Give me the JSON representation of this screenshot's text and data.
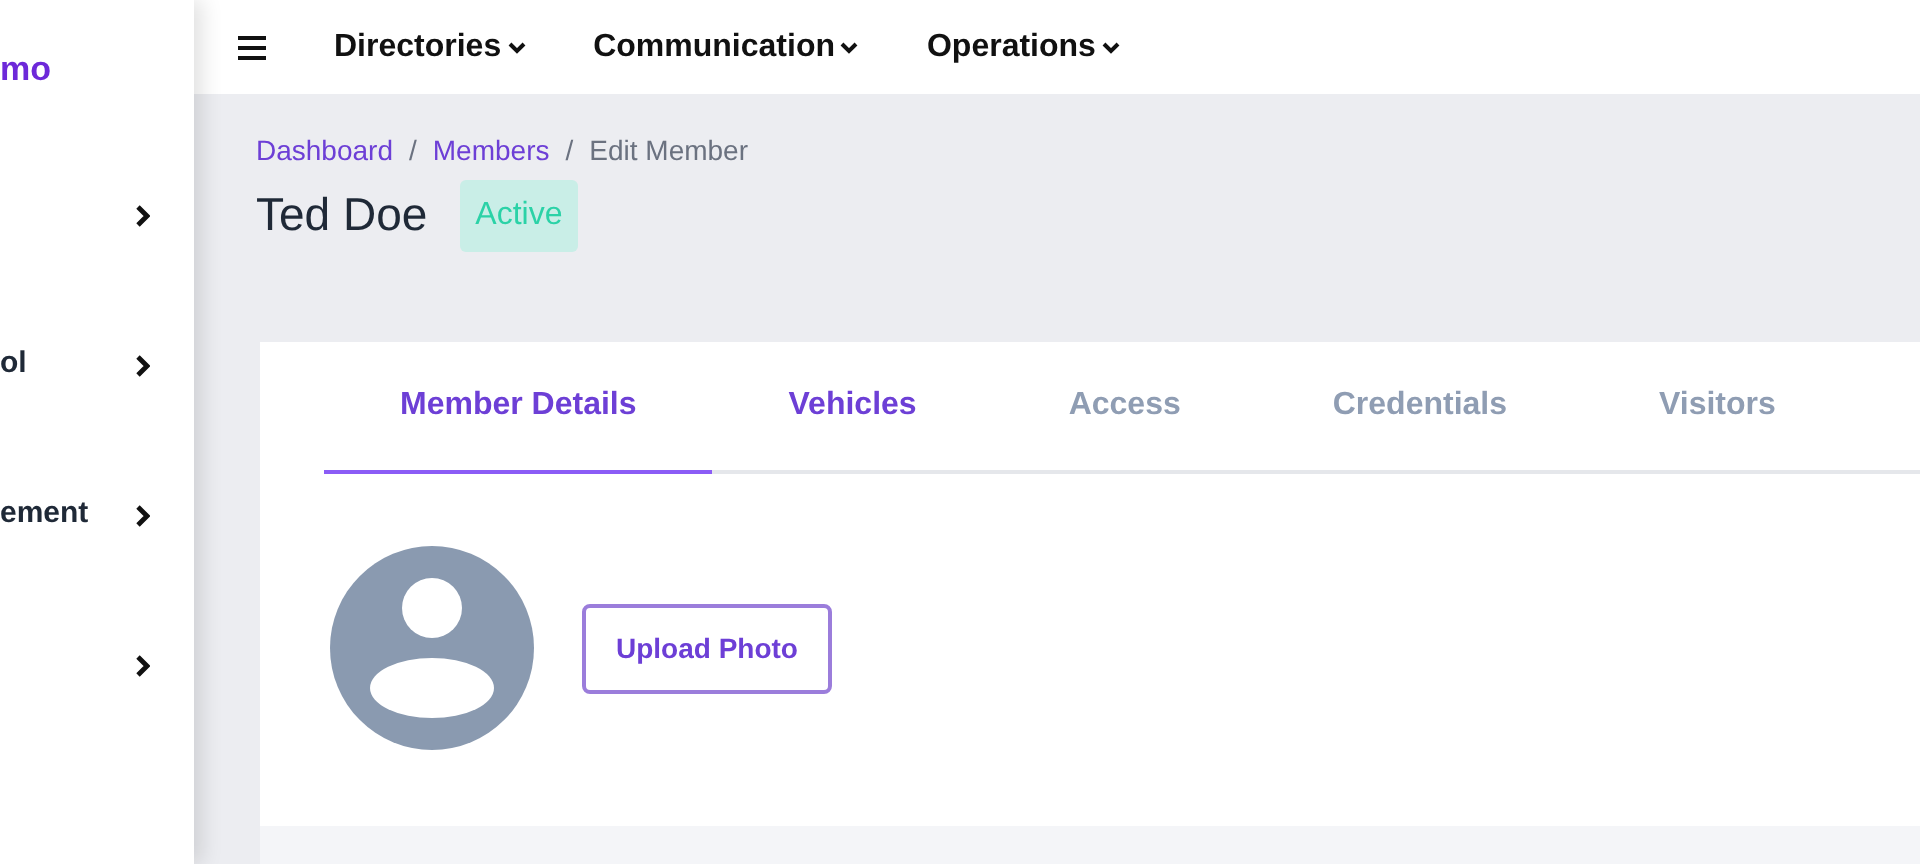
{
  "sidebar": {
    "brand": "mo",
    "items": [
      {
        "expandable": true
      },
      {
        "label": "ol",
        "expandable": true
      },
      {
        "label": "ement",
        "expandable": true
      },
      {
        "expandable": true
      }
    ]
  },
  "topnav": {
    "menu": [
      {
        "label": "Directories"
      },
      {
        "label": "Communication"
      },
      {
        "label": "Operations"
      }
    ]
  },
  "breadcrumb": [
    {
      "label": "Dashboard",
      "kind": "link",
      "separator": "/"
    },
    {
      "label": "Members",
      "kind": "link",
      "separator": "/"
    },
    {
      "label": "Edit Member",
      "kind": "current"
    }
  ],
  "member": {
    "name": "Ted Doe",
    "status": "Active"
  },
  "tabs": [
    {
      "label": "Member Details",
      "selected": true,
      "hovered": false
    },
    {
      "label": "Vehicles",
      "selected": false,
      "hovered": true
    },
    {
      "label": "Access",
      "selected": false,
      "hovered": false
    },
    {
      "label": "Credentials",
      "selected": false,
      "hovered": false
    },
    {
      "label": "Visitors",
      "selected": false,
      "hovered": false
    }
  ],
  "photo": {
    "button": "Upload Photo"
  }
}
